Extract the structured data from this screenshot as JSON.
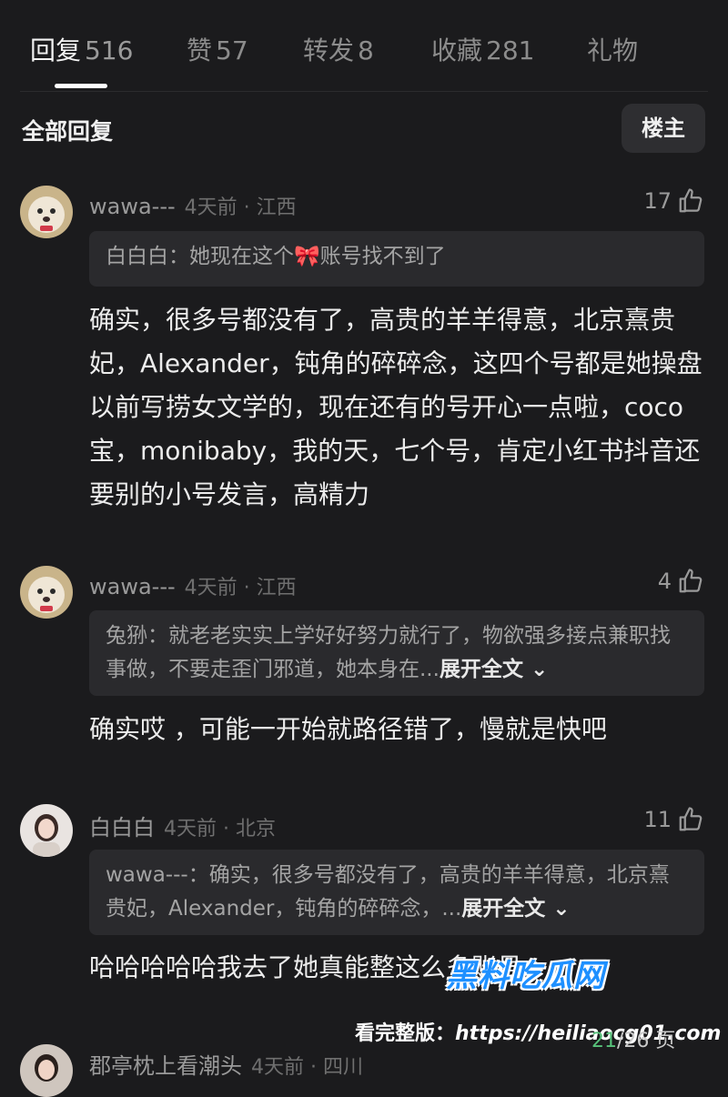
{
  "tabs": [
    {
      "label": "回复",
      "count": "516"
    },
    {
      "label": "赞",
      "count": "57"
    },
    {
      "label": "转发",
      "count": "8"
    },
    {
      "label": "收藏",
      "count": "281"
    },
    {
      "label": "礼物",
      "count": ""
    }
  ],
  "filter": {
    "title": "全部回复",
    "owner_button": "楼主"
  },
  "comments": [
    {
      "user": "wawa---",
      "info": "4天前 · 江西",
      "likes": "17",
      "quote_name": "白白白：",
      "quote_text": "她现在这个🎀账号找不到了",
      "quote_more": "",
      "body": "确实，很多号都没有了，高贵的羊羊得意，北京熹贵妃，Alexander，钝角的碎碎念，这四个号都是她操盘以前写捞女文学的，现在还有的号开心一点啦，coco宝，monibaby，我的天，七个号，肯定小红书抖音还要别的小号发言，高精力"
    },
    {
      "user": "wawa---",
      "info": "4天前 · 江西",
      "likes": "4",
      "quote_name": "兔狲：",
      "quote_text": "就老老实实上学好好努力就行了，物欲强多接点兼职找事做，不要走歪门邪道，她本身在...",
      "quote_more": "展开全文 ⌄",
      "body": "确实哎 ，可能一开始就路径错了，慢就是快吧"
    },
    {
      "user": "白白白",
      "info": "4天前 · 北京",
      "likes": "11",
      "quote_name": "wawa---：",
      "quote_text": "确实，很多号都没有了，高贵的羊羊得意，北京熹贵妃，Alexander，钝角的碎碎念，...",
      "quote_more": "展开全文 ⌄",
      "body": "哈哈哈哈哈我去了她真能整这么多账号"
    },
    {
      "user": "郡亭枕上看潮头",
      "info": "4天前 · 四川",
      "likes": ""
    }
  ],
  "watermark": {
    "brand": "黑料吃瓜网",
    "prefix": "看完整版：",
    "url": "https://heiliaocg01.com"
  },
  "page_indicator": {
    "current": "21",
    "total": "/26 页"
  }
}
